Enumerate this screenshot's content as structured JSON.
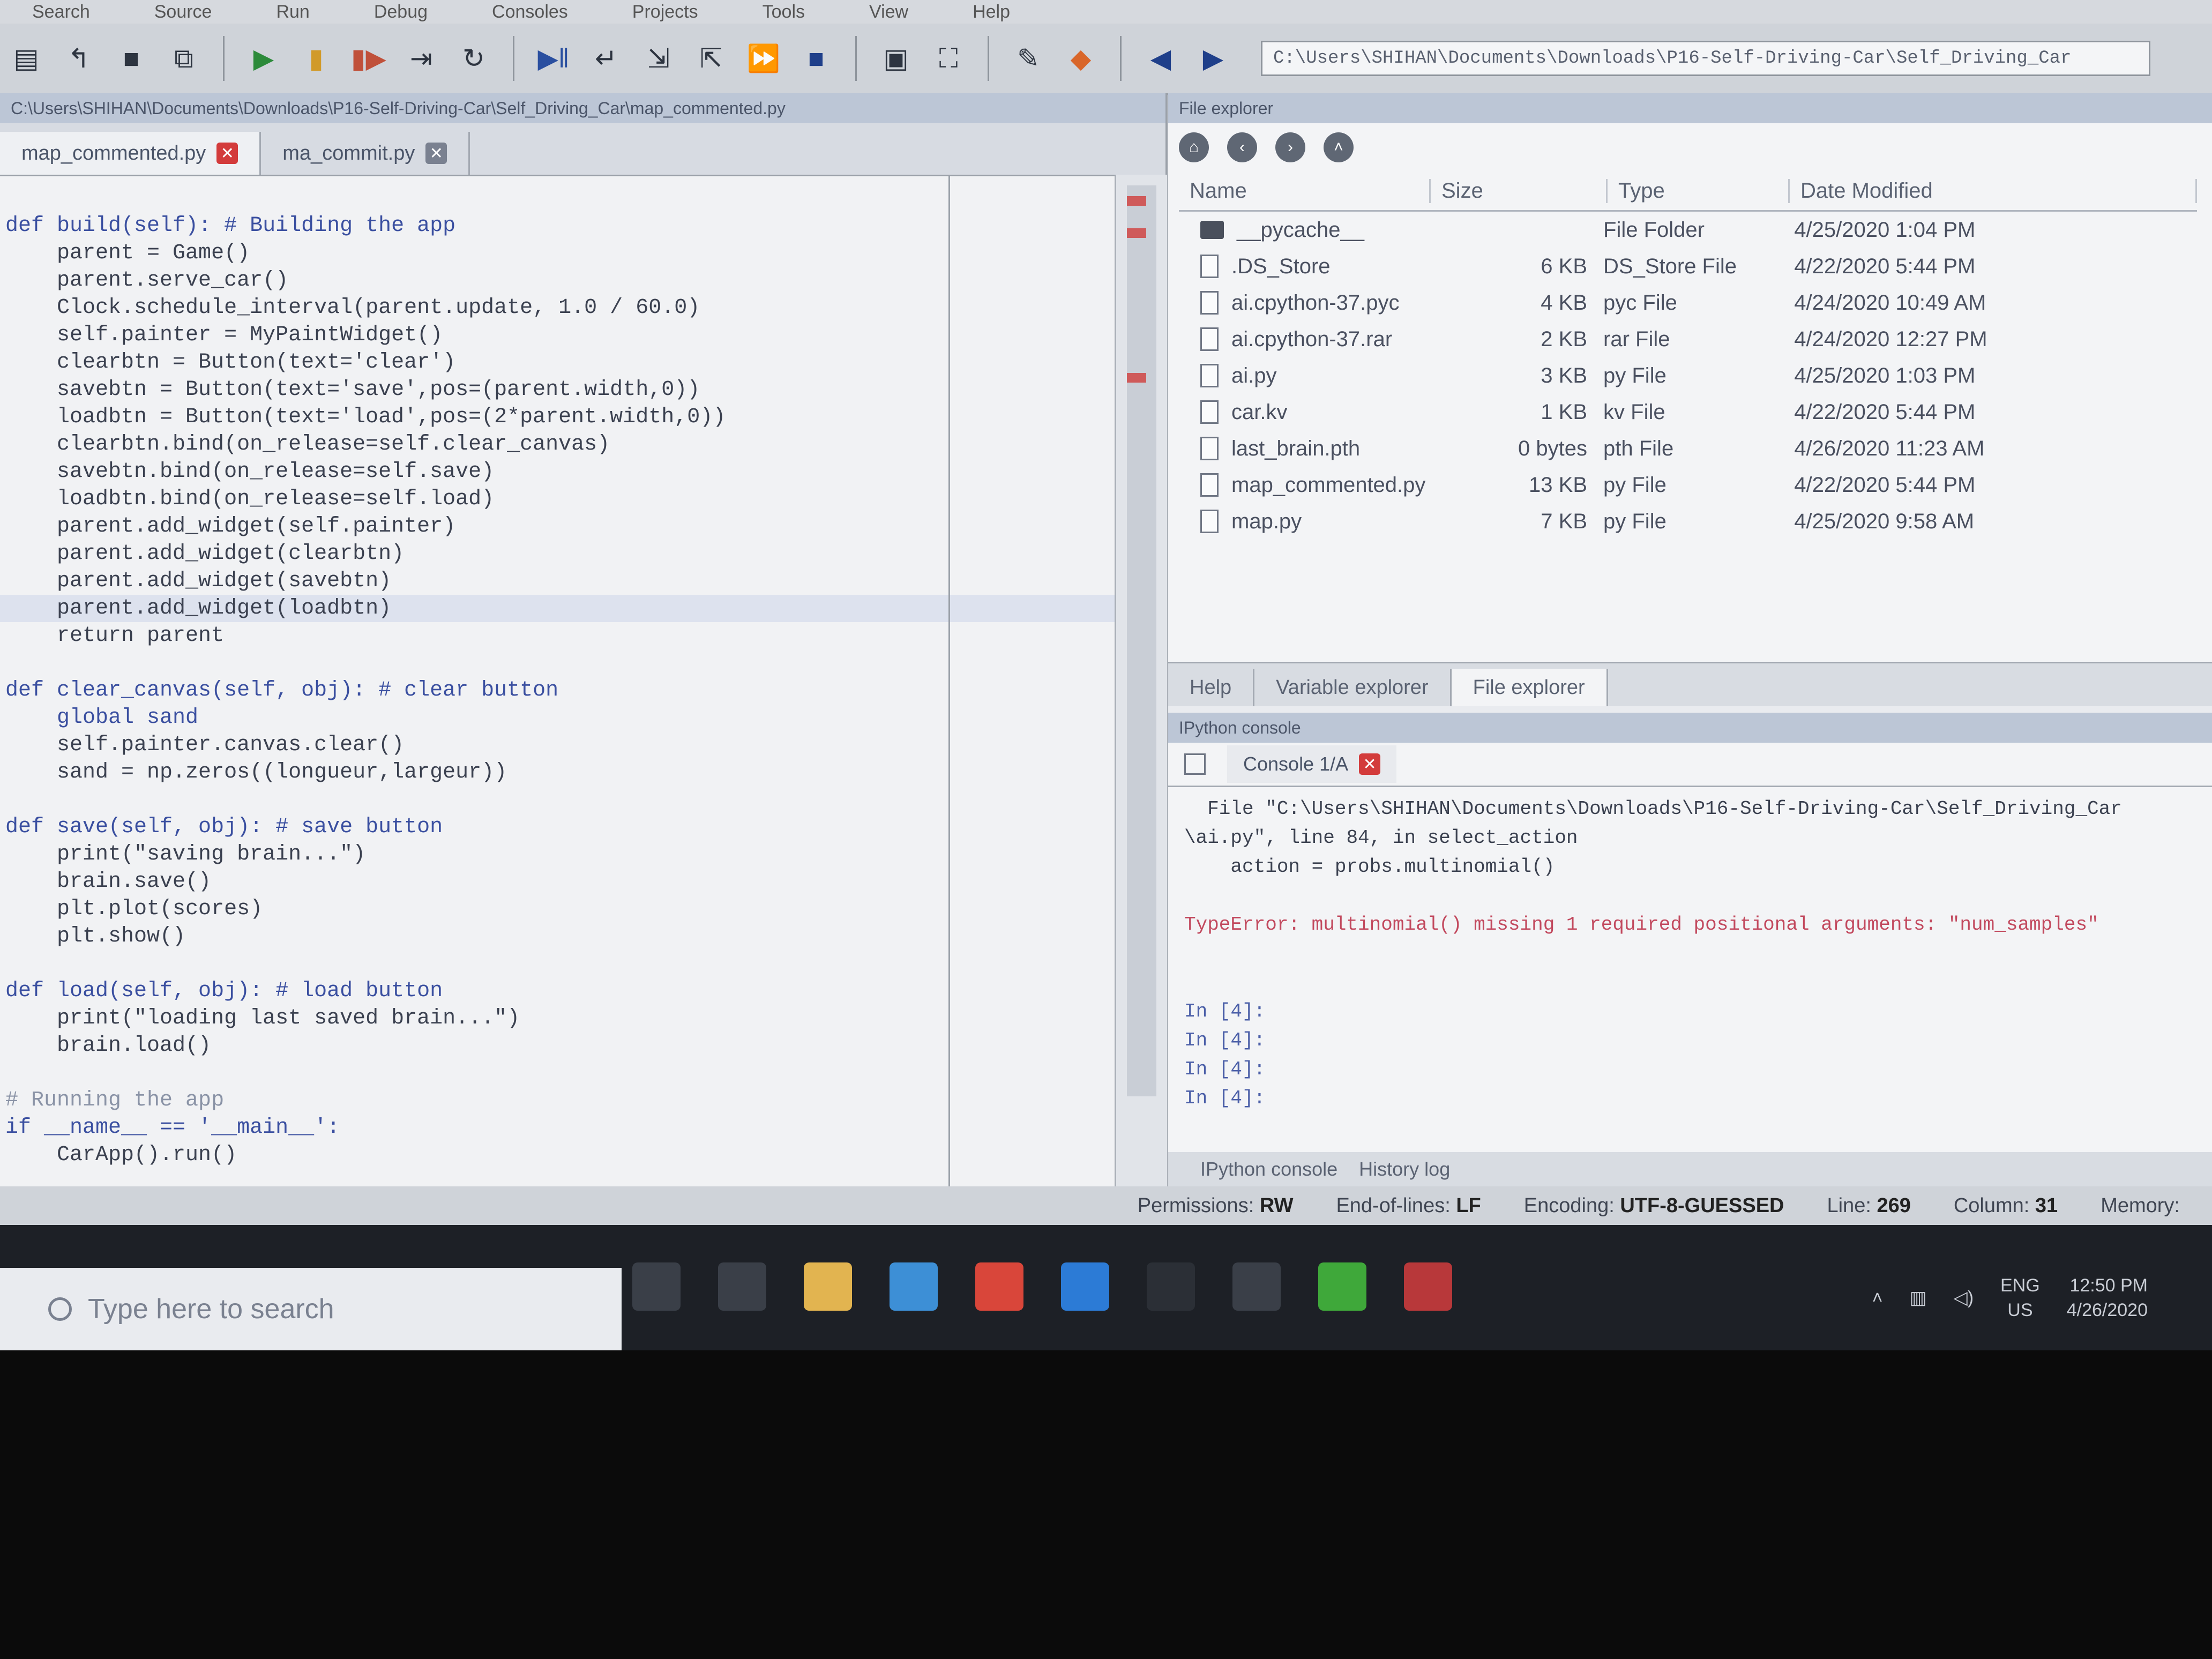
{
  "menubar": {
    "items": [
      "Search",
      "Source",
      "Run",
      "Debug",
      "Consoles",
      "Projects",
      "Tools",
      "View",
      "Help"
    ]
  },
  "toolbar": {
    "path": "C:\\Users\\SHIHAN\\Documents\\Downloads\\P16-Self-Driving-Car\\Self_Driving_Car"
  },
  "editor": {
    "path": "C:\\Users\\SHIHAN\\Documents\\Downloads\\P16-Self-Driving-Car\\Self_Driving_Car\\map_commented.py",
    "tabs": [
      {
        "label": "map_commented.py",
        "active": true
      },
      {
        "label": "ma_commit.py",
        "active": false
      }
    ],
    "lines": [
      "def build(self): # Building the app",
      "    parent = Game()",
      "    parent.serve_car()",
      "    Clock.schedule_interval(parent.update, 1.0 / 60.0)",
      "    self.painter = MyPaintWidget()",
      "    clearbtn = Button(text='clear')",
      "    savebtn = Button(text='save',pos=(parent.width,0))",
      "    loadbtn = Button(text='load',pos=(2*parent.width,0))",
      "    clearbtn.bind(on_release=self.clear_canvas)",
      "    savebtn.bind(on_release=self.save)",
      "    loadbtn.bind(on_release=self.load)",
      "    parent.add_widget(self.painter)",
      "    parent.add_widget(clearbtn)",
      "    parent.add_widget(savebtn)",
      "    parent.add_widget(loadbtn)",
      "    return parent",
      "",
      "def clear_canvas(self, obj): # clear button",
      "    global sand",
      "    self.painter.canvas.clear()",
      "    sand = np.zeros((longueur,largeur))",
      "",
      "def save(self, obj): # save button",
      "    print(\"saving brain...\")",
      "    brain.save()",
      "    plt.plot(scores)",
      "    plt.show()",
      "",
      "def load(self, obj): # load button",
      "    print(\"loading last saved brain...\")",
      "    brain.load()",
      "",
      "# Running the app",
      "if __name__ == '__main__':",
      "    CarApp().run()"
    ]
  },
  "file_explorer": {
    "title": "File explorer",
    "columns": [
      "Name",
      "Size",
      "Type",
      "Date Modified"
    ],
    "rows": [
      {
        "name": "__pycache__",
        "size": "",
        "type": "File Folder",
        "date": "4/25/2020 1:04 PM",
        "icon": "folder-icon"
      },
      {
        "name": ".DS_Store",
        "size": "6 KB",
        "type": "DS_Store File",
        "date": "4/22/2020 5:44 PM",
        "icon": "file-icon"
      },
      {
        "name": "ai.cpython-37.pyc",
        "size": "4 KB",
        "type": "pyc File",
        "date": "4/24/2020 10:49 AM",
        "icon": "file-icon"
      },
      {
        "name": "ai.cpython-37.rar",
        "size": "2 KB",
        "type": "rar File",
        "date": "4/24/2020 12:27 PM",
        "icon": "file-icon"
      },
      {
        "name": "ai.py",
        "size": "3 KB",
        "type": "py File",
        "date": "4/25/2020 1:03 PM",
        "icon": "file-icon"
      },
      {
        "name": "car.kv",
        "size": "1 KB",
        "type": "kv File",
        "date": "4/22/2020 5:44 PM",
        "icon": "file-icon"
      },
      {
        "name": "last_brain.pth",
        "size": "0 bytes",
        "type": "pth File",
        "date": "4/26/2020 11:23 AM",
        "icon": "file-icon"
      },
      {
        "name": "map_commented.py",
        "size": "13 KB",
        "type": "py File",
        "date": "4/22/2020 5:44 PM",
        "icon": "file-icon"
      },
      {
        "name": "map.py",
        "size": "7 KB",
        "type": "py File",
        "date": "4/25/2020 9:58 AM",
        "icon": "file-icon"
      }
    ],
    "pane_tabs": [
      "Help",
      "Variable explorer",
      "File explorer"
    ]
  },
  "console": {
    "title": "IPython console",
    "tab_label": "Console 1/A",
    "lines": [
      {
        "text": "  File \"C:\\Users\\SHIHAN\\Documents\\Downloads\\P16-Self-Driving-Car\\Self_Driving_Car",
        "kind": "normal"
      },
      {
        "text": "\\ai.py\", line 84, in select_action",
        "kind": "normal"
      },
      {
        "text": "    action = probs.multinomial()",
        "kind": "normal"
      },
      {
        "text": "",
        "kind": "normal"
      },
      {
        "text": "TypeError: multinomial() missing 1 required positional arguments: \"num_samples\"",
        "kind": "error"
      },
      {
        "text": "",
        "kind": "normal"
      },
      {
        "text": "",
        "kind": "normal"
      },
      {
        "text": "In [4]:",
        "kind": "prompt"
      },
      {
        "text": "In [4]:",
        "kind": "prompt"
      },
      {
        "text": "In [4]:",
        "kind": "prompt"
      },
      {
        "text": "In [4]:",
        "kind": "prompt"
      }
    ],
    "bottom_tabs": [
      "IPython console",
      "History log"
    ]
  },
  "statusbar": {
    "permissions_label": "Permissions:",
    "permissions": "RW",
    "eol_label": "End-of-lines:",
    "eol": "LF",
    "encoding_label": "Encoding:",
    "encoding": "UTF-8-GUESSED",
    "line_label": "Line:",
    "line": "269",
    "column_label": "Column:",
    "column": "31",
    "memory_label": "Memory:"
  },
  "taskbar": {
    "search_placeholder": "Type here to search",
    "clock_time": "12:50 PM",
    "clock_date": "4/26/2020",
    "language": "ENG",
    "region": "US",
    "icons": [
      {
        "name": "cortana-icon",
        "color": "#3a3f48"
      },
      {
        "name": "task-view-icon",
        "color": "#3a3f48"
      },
      {
        "name": "file-explorer-icon",
        "color": "#e2b450"
      },
      {
        "name": "mail-icon",
        "color": "#3d8fd6"
      },
      {
        "name": "chrome-icon",
        "color": "#d9463a"
      },
      {
        "name": "store-icon",
        "color": "#2c7bd6"
      },
      {
        "name": "terminal-icon",
        "color": "#2b2f36"
      },
      {
        "name": "calculator-icon",
        "color": "#3a3f48"
      },
      {
        "name": "anaconda-icon",
        "color": "#3fa83a"
      },
      {
        "name": "spyder-icon",
        "color": "#b8383a"
      }
    ]
  }
}
